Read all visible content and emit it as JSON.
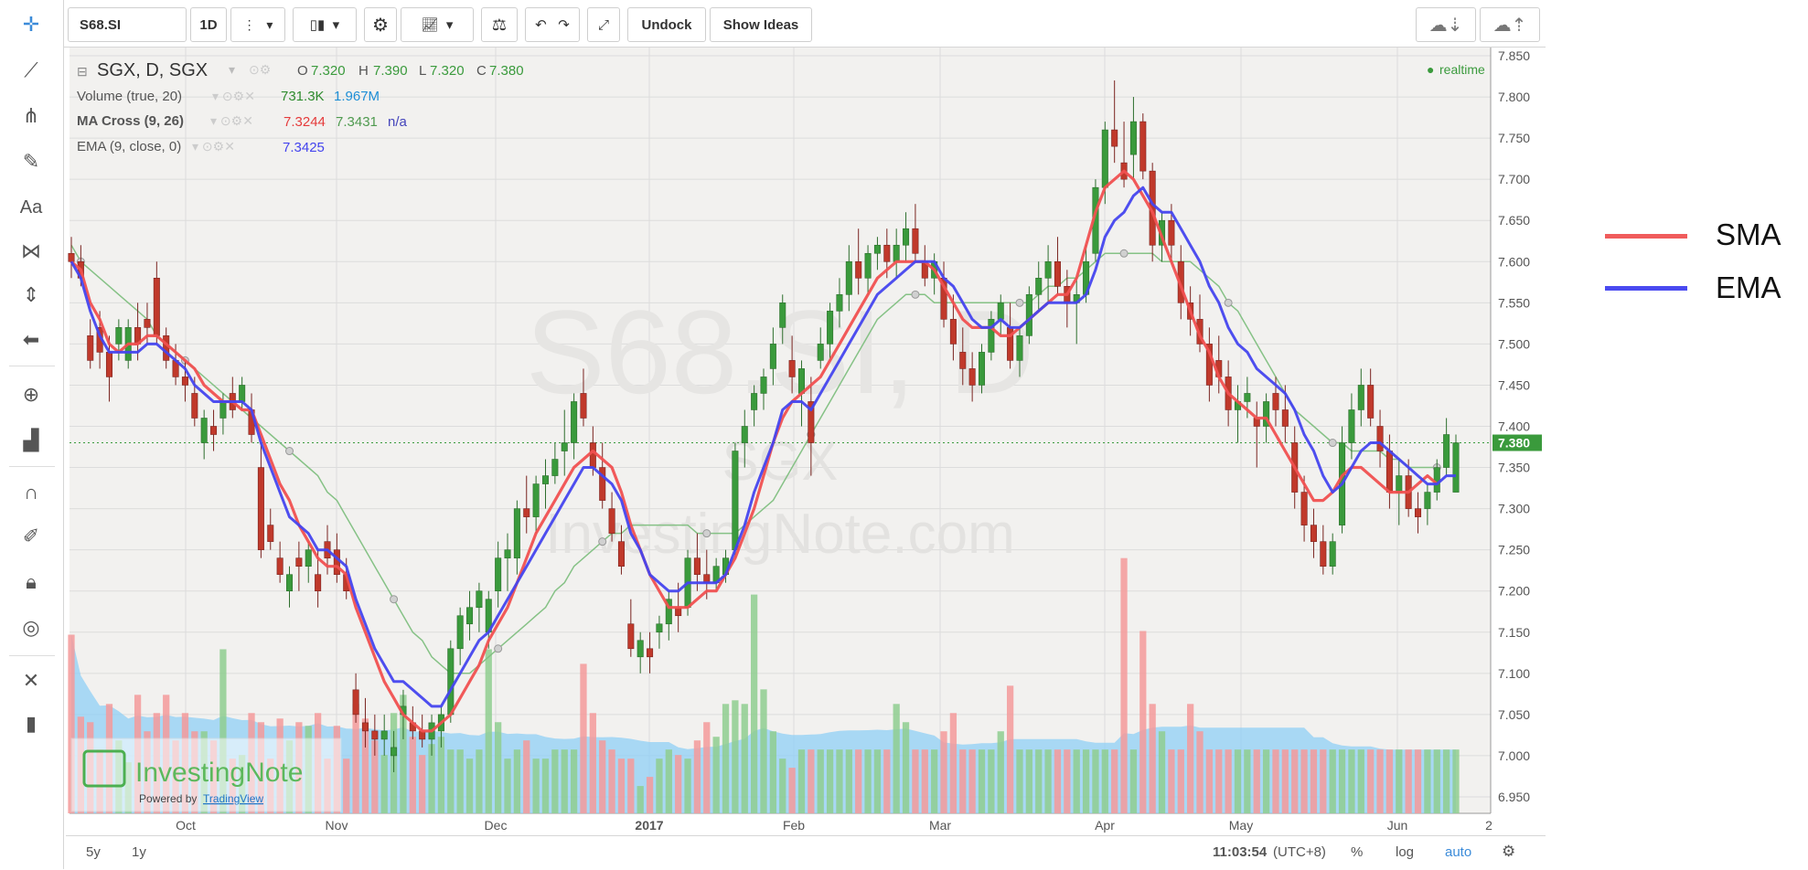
{
  "toolbar": {
    "symbol": "S68.SI",
    "interval": "1D",
    "undock_label": "Undock",
    "show_ideas_label": "Show Ideas"
  },
  "legend": {
    "main_title": "SGX, D, SGX",
    "o_label": "O",
    "o_value": "7.320",
    "h_label": "H",
    "h_value": "7.390",
    "l_label": "L",
    "l_value": "7.320",
    "c_label": "C",
    "c_value": "7.380",
    "realtime": "realtime",
    "volume_label": "Volume (true, 20)",
    "volume_v1": "731.3K",
    "volume_v2": "1.967M",
    "macross_label": "MA Cross (9, 26)",
    "macross_v1": "7.3244",
    "macross_v2": "7.3431",
    "macross_v3": "n/a",
    "ema_label": "EMA (9, close, 0)",
    "ema_v1": "7.3425"
  },
  "watermark": {
    "line1": "S68.SI, D",
    "line2": "SGX",
    "line3": "InvestingNote.com"
  },
  "logo": {
    "name": "InvestingNote",
    "powered_by": "Powered by",
    "powered_link": "TradingView"
  },
  "bottom": {
    "range_5y": "5y",
    "range_1y": "1y",
    "time": "11:03:54",
    "tz": "(UTC+8)",
    "pct": "%",
    "log": "log",
    "auto": "auto"
  },
  "outer_legend": {
    "sma_label": "SMA",
    "ema_label": "EMA"
  },
  "colors": {
    "up": "#3a9a3c",
    "down": "#c0392b",
    "sma": "#f05050",
    "ema": "#4444ee",
    "slow_ma": "#7fbf7f",
    "vol_up": "#8fce8f",
    "vol_down": "#f49a9a",
    "vol_ma": "#8fcff5"
  },
  "chart_data": {
    "type": "candlestick",
    "y_ticks": [
      "7.850",
      "7.800",
      "7.750",
      "7.700",
      "7.650",
      "7.600",
      "7.550",
      "7.500",
      "7.450",
      "7.400",
      "7.350",
      "7.300",
      "7.250",
      "7.200",
      "7.150",
      "7.100",
      "7.050",
      "7.000",
      "6.950"
    ],
    "ylim": [
      6.93,
      7.86
    ],
    "last_price": "7.380",
    "x_tick_labels": [
      "Oct",
      "Nov",
      "Dec",
      "2017",
      "Feb",
      "Mar",
      "Apr",
      "May",
      "Jun",
      "2"
    ],
    "candles": [
      [
        7.61,
        7.63,
        7.58,
        7.6
      ],
      [
        7.6,
        7.62,
        7.57,
        7.58
      ],
      [
        7.51,
        7.53,
        7.47,
        7.48
      ],
      [
        7.52,
        7.54,
        7.47,
        7.49
      ],
      [
        7.49,
        7.51,
        7.43,
        7.46
      ],
      [
        7.5,
        7.53,
        7.48,
        7.52
      ],
      [
        7.48,
        7.53,
        7.47,
        7.52
      ],
      [
        7.52,
        7.55,
        7.48,
        7.5
      ],
      [
        7.53,
        7.55,
        7.5,
        7.52
      ],
      [
        7.58,
        7.6,
        7.5,
        7.51
      ],
      [
        7.51,
        7.52,
        7.47,
        7.48
      ],
      [
        7.48,
        7.5,
        7.45,
        7.46
      ],
      [
        7.46,
        7.48,
        7.43,
        7.45
      ],
      [
        7.44,
        7.46,
        7.4,
        7.41
      ],
      [
        7.38,
        7.42,
        7.36,
        7.41
      ],
      [
        7.4,
        7.42,
        7.37,
        7.39
      ],
      [
        7.41,
        7.44,
        7.39,
        7.43
      ],
      [
        7.44,
        7.46,
        7.41,
        7.42
      ],
      [
        7.43,
        7.46,
        7.42,
        7.45
      ],
      [
        7.42,
        7.44,
        7.38,
        7.39
      ],
      [
        7.35,
        7.38,
        7.24,
        7.25
      ],
      [
        7.28,
        7.3,
        7.25,
        7.26
      ],
      [
        7.24,
        7.26,
        7.21,
        7.22
      ],
      [
        7.2,
        7.23,
        7.18,
        7.22
      ],
      [
        7.24,
        7.26,
        7.2,
        7.23
      ],
      [
        7.23,
        7.26,
        7.21,
        7.25
      ],
      [
        7.22,
        7.25,
        7.18,
        7.2
      ],
      [
        7.26,
        7.28,
        7.22,
        7.24
      ],
      [
        7.25,
        7.27,
        7.21,
        7.22
      ],
      [
        7.22,
        7.24,
        7.19,
        7.2
      ],
      [
        7.08,
        7.1,
        7.04,
        7.05
      ],
      [
        7.04,
        7.07,
        7.01,
        7.03
      ],
      [
        7.03,
        7.05,
        7.0,
        7.02
      ],
      [
        7.02,
        7.05,
        7.0,
        7.03
      ],
      [
        7.0,
        7.03,
        6.98,
        7.01
      ],
      [
        7.05,
        7.08,
        7.02,
        7.06
      ],
      [
        7.04,
        7.06,
        7.02,
        7.03
      ],
      [
        7.03,
        7.05,
        7.01,
        7.02
      ],
      [
        7.02,
        7.05,
        7.0,
        7.04
      ],
      [
        7.03,
        7.06,
        7.01,
        7.05
      ],
      [
        7.05,
        7.14,
        7.04,
        7.13
      ],
      [
        7.13,
        7.18,
        7.11,
        7.17
      ],
      [
        7.16,
        7.2,
        7.14,
        7.18
      ],
      [
        7.18,
        7.21,
        7.15,
        7.2
      ],
      [
        7.15,
        7.2,
        7.13,
        7.19
      ],
      [
        7.2,
        7.26,
        7.18,
        7.24
      ],
      [
        7.24,
        7.27,
        7.2,
        7.25
      ],
      [
        7.24,
        7.31,
        7.22,
        7.3
      ],
      [
        7.3,
        7.34,
        7.27,
        7.29
      ],
      [
        7.29,
        7.34,
        7.27,
        7.33
      ],
      [
        7.33,
        7.36,
        7.3,
        7.34
      ],
      [
        7.34,
        7.38,
        7.33,
        7.36
      ],
      [
        7.37,
        7.42,
        7.34,
        7.38
      ],
      [
        7.38,
        7.44,
        7.36,
        7.43
      ],
      [
        7.44,
        7.47,
        7.4,
        7.41
      ],
      [
        7.38,
        7.4,
        7.34,
        7.35
      ],
      [
        7.35,
        7.38,
        7.3,
        7.31
      ],
      [
        7.3,
        7.32,
        7.26,
        7.27
      ],
      [
        7.26,
        7.28,
        7.22,
        7.23
      ],
      [
        7.16,
        7.19,
        7.12,
        7.13
      ],
      [
        7.12,
        7.15,
        7.1,
        7.14
      ],
      [
        7.13,
        7.15,
        7.1,
        7.12
      ],
      [
        7.15,
        7.17,
        7.13,
        7.16
      ],
      [
        7.16,
        7.2,
        7.14,
        7.19
      ],
      [
        7.18,
        7.21,
        7.15,
        7.17
      ],
      [
        7.18,
        7.25,
        7.17,
        7.24
      ],
      [
        7.24,
        7.27,
        7.2,
        7.22
      ],
      [
        7.22,
        7.25,
        7.19,
        7.21
      ],
      [
        7.21,
        7.24,
        7.2,
        7.23
      ],
      [
        7.22,
        7.25,
        7.21,
        7.24
      ],
      [
        7.25,
        7.38,
        7.24,
        7.37
      ],
      [
        7.38,
        7.42,
        7.35,
        7.4
      ],
      [
        7.42,
        7.45,
        7.4,
        7.44
      ],
      [
        7.44,
        7.47,
        7.42,
        7.46
      ],
      [
        7.47,
        7.52,
        7.45,
        7.5
      ],
      [
        7.52,
        7.56,
        7.5,
        7.55
      ],
      [
        7.48,
        7.51,
        7.44,
        7.46
      ],
      [
        7.44,
        7.48,
        7.4,
        7.47
      ],
      [
        7.43,
        7.46,
        7.34,
        7.38
      ],
      [
        7.48,
        7.52,
        7.47,
        7.5
      ],
      [
        7.5,
        7.55,
        7.48,
        7.54
      ],
      [
        7.54,
        7.58,
        7.52,
        7.56
      ],
      [
        7.56,
        7.62,
        7.54,
        7.6
      ],
      [
        7.6,
        7.64,
        7.56,
        7.58
      ],
      [
        7.58,
        7.62,
        7.56,
        7.61
      ],
      [
        7.61,
        7.63,
        7.59,
        7.62
      ],
      [
        7.62,
        7.64,
        7.58,
        7.6
      ],
      [
        7.6,
        7.64,
        7.58,
        7.62
      ],
      [
        7.62,
        7.66,
        7.6,
        7.64
      ],
      [
        7.64,
        7.67,
        7.6,
        7.61
      ],
      [
        7.6,
        7.62,
        7.57,
        7.58
      ],
      [
        7.58,
        7.61,
        7.56,
        7.6
      ],
      [
        7.58,
        7.6,
        7.52,
        7.53
      ],
      [
        7.53,
        7.56,
        7.48,
        7.5
      ],
      [
        7.49,
        7.52,
        7.45,
        7.47
      ],
      [
        7.47,
        7.49,
        7.43,
        7.45
      ],
      [
        7.45,
        7.5,
        7.44,
        7.49
      ],
      [
        7.49,
        7.54,
        7.48,
        7.53
      ],
      [
        7.53,
        7.56,
        7.51,
        7.55
      ],
      [
        7.52,
        7.55,
        7.47,
        7.48
      ],
      [
        7.48,
        7.52,
        7.46,
        7.51
      ],
      [
        7.51,
        7.57,
        7.5,
        7.56
      ],
      [
        7.56,
        7.6,
        7.54,
        7.58
      ],
      [
        7.58,
        7.62,
        7.55,
        7.6
      ],
      [
        7.6,
        7.63,
        7.56,
        7.57
      ],
      [
        7.57,
        7.59,
        7.52,
        7.55
      ],
      [
        7.55,
        7.58,
        7.5,
        7.56
      ],
      [
        7.56,
        7.62,
        7.55,
        7.6
      ],
      [
        7.61,
        7.7,
        7.6,
        7.69
      ],
      [
        7.69,
        7.77,
        7.67,
        7.76
      ],
      [
        7.76,
        7.82,
        7.72,
        7.74
      ],
      [
        7.72,
        7.77,
        7.69,
        7.7
      ],
      [
        7.73,
        7.8,
        7.7,
        7.77
      ],
      [
        7.77,
        7.78,
        7.7,
        7.71
      ],
      [
        7.71,
        7.72,
        7.6,
        7.62
      ],
      [
        7.62,
        7.66,
        7.6,
        7.65
      ],
      [
        7.65,
        7.67,
        7.6,
        7.62
      ],
      [
        7.6,
        7.62,
        7.53,
        7.55
      ],
      [
        7.55,
        7.57,
        7.51,
        7.53
      ],
      [
        7.53,
        7.56,
        7.49,
        7.5
      ],
      [
        7.5,
        7.52,
        7.43,
        7.45
      ],
      [
        7.48,
        7.51,
        7.44,
        7.46
      ],
      [
        7.46,
        7.48,
        7.4,
        7.42
      ],
      [
        7.42,
        7.45,
        7.38,
        7.43
      ],
      [
        7.43,
        7.46,
        7.41,
        7.44
      ],
      [
        7.41,
        7.43,
        7.35,
        7.4
      ],
      [
        7.4,
        7.44,
        7.38,
        7.43
      ],
      [
        7.44,
        7.46,
        7.4,
        7.42
      ],
      [
        7.42,
        7.45,
        7.38,
        7.4
      ],
      [
        7.38,
        7.4,
        7.3,
        7.32
      ],
      [
        7.32,
        7.34,
        7.26,
        7.28
      ],
      [
        7.28,
        7.3,
        7.24,
        7.26
      ],
      [
        7.26,
        7.28,
        7.22,
        7.23
      ],
      [
        7.23,
        7.27,
        7.22,
        7.26
      ],
      [
        7.28,
        7.4,
        7.27,
        7.38
      ],
      [
        7.38,
        7.44,
        7.36,
        7.42
      ],
      [
        7.42,
        7.47,
        7.4,
        7.45
      ],
      [
        7.45,
        7.47,
        7.4,
        7.41
      ],
      [
        7.4,
        7.42,
        7.35,
        7.37
      ],
      [
        7.37,
        7.39,
        7.3,
        7.32
      ],
      [
        7.32,
        7.36,
        7.28,
        7.34
      ],
      [
        7.34,
        7.36,
        7.29,
        7.3
      ],
      [
        7.3,
        7.32,
        7.27,
        7.29
      ],
      [
        7.3,
        7.33,
        7.28,
        7.32
      ],
      [
        7.32,
        7.36,
        7.31,
        7.35
      ],
      [
        7.35,
        7.41,
        7.34,
        7.39
      ],
      [
        7.32,
        7.39,
        7.32,
        7.38
      ]
    ],
    "sma_9": [
      7.6,
      7.59,
      7.55,
      7.53,
      7.5,
      7.49,
      7.5,
      7.5,
      7.51,
      7.51,
      7.5,
      7.49,
      7.48,
      7.47,
      7.45,
      7.44,
      7.43,
      7.43,
      7.42,
      7.42,
      7.39,
      7.36,
      7.33,
      7.31,
      7.28,
      7.26,
      7.24,
      7.23,
      7.23,
      7.22,
      7.18,
      7.15,
      7.12,
      7.09,
      7.07,
      7.05,
      7.04,
      7.03,
      7.03,
      7.04,
      7.05,
      7.07,
      7.09,
      7.11,
      7.14,
      7.16,
      7.18,
      7.21,
      7.24,
      7.27,
      7.29,
      7.31,
      7.33,
      7.35,
      7.36,
      7.37,
      7.36,
      7.35,
      7.32,
      7.28,
      7.25,
      7.22,
      7.2,
      7.18,
      7.18,
      7.18,
      7.19,
      7.2,
      7.2,
      7.22,
      7.24,
      7.27,
      7.3,
      7.34,
      7.38,
      7.41,
      7.43,
      7.44,
      7.45,
      7.46,
      7.48,
      7.5,
      7.52,
      7.54,
      7.56,
      7.58,
      7.59,
      7.6,
      7.6,
      7.6,
      7.6,
      7.59,
      7.57,
      7.55,
      7.53,
      7.52,
      7.52,
      7.52,
      7.51,
      7.51,
      7.52,
      7.53,
      7.54,
      7.55,
      7.56,
      7.56,
      7.58,
      7.62,
      7.66,
      7.69,
      7.7,
      7.71,
      7.7,
      7.68,
      7.66,
      7.63,
      7.6,
      7.57,
      7.54,
      7.51,
      7.49,
      7.46,
      7.44,
      7.43,
      7.42,
      7.41,
      7.41,
      7.39,
      7.37,
      7.35,
      7.33,
      7.31,
      7.31,
      7.32,
      7.34,
      7.35,
      7.35,
      7.34,
      7.33,
      7.32,
      7.32,
      7.32,
      7.33,
      7.34,
      7.33
    ],
    "ema_9": [
      7.6,
      7.58,
      7.54,
      7.51,
      7.49,
      7.49,
      7.49,
      7.49,
      7.5,
      7.5,
      7.49,
      7.48,
      7.47,
      7.45,
      7.44,
      7.43,
      7.43,
      7.43,
      7.43,
      7.42,
      7.38,
      7.35,
      7.32,
      7.29,
      7.28,
      7.27,
      7.25,
      7.25,
      7.24,
      7.23,
      7.19,
      7.16,
      7.13,
      7.11,
      7.09,
      7.09,
      7.08,
      7.07,
      7.06,
      7.06,
      7.08,
      7.1,
      7.12,
      7.14,
      7.15,
      7.17,
      7.19,
      7.21,
      7.23,
      7.25,
      7.27,
      7.29,
      7.31,
      7.33,
      7.35,
      7.35,
      7.34,
      7.33,
      7.31,
      7.27,
      7.25,
      7.22,
      7.21,
      7.2,
      7.2,
      7.21,
      7.21,
      7.21,
      7.21,
      7.22,
      7.25,
      7.28,
      7.32,
      7.35,
      7.38,
      7.42,
      7.43,
      7.43,
      7.42,
      7.44,
      7.46,
      7.48,
      7.5,
      7.52,
      7.54,
      7.56,
      7.57,
      7.58,
      7.59,
      7.6,
      7.6,
      7.6,
      7.58,
      7.57,
      7.55,
      7.53,
      7.52,
      7.52,
      7.53,
      7.52,
      7.52,
      7.53,
      7.54,
      7.55,
      7.55,
      7.55,
      7.55,
      7.56,
      7.59,
      7.63,
      7.65,
      7.66,
      7.68,
      7.69,
      7.67,
      7.66,
      7.66,
      7.64,
      7.62,
      7.6,
      7.57,
      7.55,
      7.52,
      7.5,
      7.49,
      7.47,
      7.46,
      7.45,
      7.44,
      7.42,
      7.39,
      7.37,
      7.34,
      7.32,
      7.33,
      7.35,
      7.37,
      7.38,
      7.38,
      7.37,
      7.36,
      7.35,
      7.34,
      7.33,
      7.33,
      7.34,
      7.34
    ],
    "slow_ma_26": [
      7.62,
      7.6,
      7.59,
      7.58,
      7.57,
      7.56,
      7.55,
      7.54,
      7.53,
      7.51,
      7.5,
      7.49,
      7.48,
      7.47,
      7.46,
      7.45,
      7.44,
      7.43,
      7.42,
      7.41,
      7.4,
      7.39,
      7.38,
      7.37,
      7.36,
      7.35,
      7.34,
      7.32,
      7.31,
      7.29,
      7.27,
      7.25,
      7.23,
      7.21,
      7.19,
      7.17,
      7.15,
      7.14,
      7.12,
      7.11,
      7.1,
      7.1,
      7.1,
      7.11,
      7.12,
      7.13,
      7.14,
      7.15,
      7.16,
      7.17,
      7.18,
      7.2,
      7.21,
      7.23,
      7.24,
      7.25,
      7.26,
      7.27,
      7.27,
      7.28,
      7.28,
      7.28,
      7.28,
      7.28,
      7.28,
      7.28,
      7.27,
      7.27,
      7.27,
      7.27,
      7.27,
      7.28,
      7.29,
      7.3,
      7.31,
      7.33,
      7.35,
      7.37,
      7.39,
      7.41,
      7.43,
      7.45,
      7.47,
      7.49,
      7.51,
      7.53,
      7.54,
      7.55,
      7.56,
      7.56,
      7.56,
      7.55,
      7.55,
      7.55,
      7.55,
      7.55,
      7.55,
      7.55,
      7.55,
      7.55,
      7.55,
      7.55,
      7.56,
      7.57,
      7.57,
      7.58,
      7.58,
      7.59,
      7.6,
      7.61,
      7.61,
      7.61,
      7.61,
      7.61,
      7.61,
      7.6,
      7.6,
      7.6,
      7.6,
      7.59,
      7.58,
      7.57,
      7.55,
      7.54,
      7.52,
      7.5,
      7.48,
      7.46,
      7.44,
      7.42,
      7.41,
      7.4,
      7.39,
      7.38,
      7.38,
      7.37,
      7.37,
      7.37,
      7.37,
      7.36,
      7.36,
      7.35,
      7.35,
      7.35,
      7.35
    ],
    "volume": [
      0.98,
      0.53,
      0.5,
      0.35,
      0.6,
      0.4,
      0.28,
      0.65,
      0.45,
      0.55,
      0.65,
      0.4,
      0.55,
      0.45,
      0.45,
      0.4,
      0.9,
      0.3,
      0.32,
      0.55,
      0.5,
      0.3,
      0.52,
      0.4,
      0.5,
      0.48,
      0.55,
      0.3,
      0.48,
      0.3,
      0.6,
      0.52,
      0.4,
      0.32,
      0.55,
      0.65,
      0.42,
      0.32,
      0.38,
      0.42,
      0.35,
      0.35,
      0.3,
      0.35,
      0.9,
      0.5,
      0.3,
      0.35,
      0.4,
      0.3,
      0.3,
      0.35,
      0.35,
      0.35,
      0.82,
      0.55,
      0.4,
      0.35,
      0.3,
      0.3,
      0.15,
      0.2,
      0.3,
      0.35,
      0.32,
      0.3,
      0.4,
      0.5,
      0.42,
      0.6,
      0.62,
      0.6,
      1.2,
      0.68,
      0.45,
      0.3,
      0.25,
      0.35,
      0.35,
      0.35,
      0.35,
      0.35,
      0.35,
      0.35,
      0.35,
      0.35,
      0.35,
      0.6,
      0.5,
      0.35,
      0.35,
      0.35,
      0.45,
      0.55,
      0.35,
      0.35,
      0.35,
      0.35,
      0.45,
      0.7,
      0.35,
      0.35,
      0.35,
      0.35,
      0.35,
      0.35,
      0.35,
      0.35,
      0.35,
      0.35,
      0.35,
      1.4,
      0.35,
      1.0,
      0.6,
      0.45,
      0.35,
      0.35,
      0.6,
      0.45,
      0.35,
      0.35,
      0.35,
      0.35,
      0.35,
      0.35,
      0.35,
      0.35,
      0.35,
      0.35,
      0.35,
      0.35,
      0.35,
      0.35,
      0.35,
      0.35,
      0.35,
      0.35,
      0.35,
      0.35,
      0.35,
      0.35,
      0.35,
      0.35,
      0.35,
      0.35,
      0.35
    ]
  }
}
